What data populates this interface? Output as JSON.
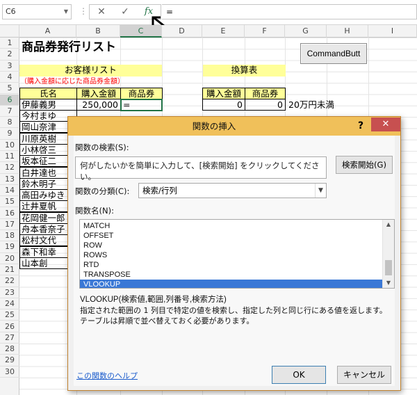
{
  "formula_bar": {
    "name_box": "C6",
    "separator": "⋮",
    "cancel_icon": "✕",
    "enter_icon": "✓",
    "fx_label": "fx",
    "formula": "="
  },
  "columns": [
    "A",
    "B",
    "C",
    "D",
    "E",
    "F",
    "G",
    "H",
    "I"
  ],
  "rows": [
    "1",
    "2",
    "3",
    "4",
    "5",
    "6",
    "7",
    "8",
    "9",
    "10",
    "11",
    "12",
    "13",
    "14",
    "15",
    "16",
    "17",
    "18",
    "19",
    "20",
    "21",
    "22",
    "23",
    "24",
    "25",
    "26",
    "27",
    "28",
    "29",
    "30"
  ],
  "sheet": {
    "title": "商品券発行リスト",
    "customer_header": "お客様リスト",
    "note": "（購入金額に応じた商品券金額）",
    "col_name": "氏名",
    "col_purchase": "購入金額",
    "col_voucher": "商品券",
    "first_name": "伊藤義男",
    "first_amount": "250,000",
    "active_value": "=",
    "names": [
      "今村まゆ",
      "岡山奈津",
      "川原英樹",
      "小林啓三",
      "坂本征二",
      "白井達也",
      "鈴木明子",
      "高田みゆき",
      "辻井夏帆",
      "花岡健一郎",
      "舟本香奈子",
      "松村文代",
      "森下和幸",
      "山本創"
    ],
    "conv_header": "換算表",
    "conv_col_purchase": "購入金額",
    "conv_col_voucher": "商品券",
    "conv_row1_purchase": "0",
    "conv_row1_voucher": "0",
    "conv_row1_note": "20万円未満",
    "command_button": "CommandButt"
  },
  "dialog": {
    "title": "関数の挿入",
    "help": "?",
    "close": "✕",
    "search_label": "関数の検索(S):",
    "search_text": "何がしたいかを簡単に入力して、[検索開始] をクリックしてください。",
    "search_button": "検索開始(G)",
    "category_label": "関数の分類(C):",
    "category_value": "検索/行列",
    "func_label": "関数名(N):",
    "functions": [
      "MATCH",
      "OFFSET",
      "ROW",
      "ROWS",
      "RTD",
      "TRANSPOSE",
      "VLOOKUP"
    ],
    "selected_function": "VLOOKUP",
    "syntax": "VLOOKUP(検索値,範囲,列番号,検索方法)",
    "description": "指定された範囲の 1 列目で特定の値を検索し、指定した列と同じ行にある値を返します。テーブルは昇順で並べ替えておく必要があります。",
    "help_link": "この関数のヘルプ",
    "ok": "OK",
    "cancel": "キャンセル"
  },
  "colors": {
    "accent_green": "#217346",
    "dialog_title": "#f0c05a",
    "close_red": "#c75050",
    "selection_blue": "#3a78d6",
    "header_yellow": "#ffff99",
    "note_red": "#ff0000"
  },
  "icons": {
    "name_box_dropdown": "chevron-down-icon",
    "cancel": "close-icon",
    "enter": "check-icon",
    "fx": "function-icon",
    "arrow": "arrow-annotation-icon"
  }
}
